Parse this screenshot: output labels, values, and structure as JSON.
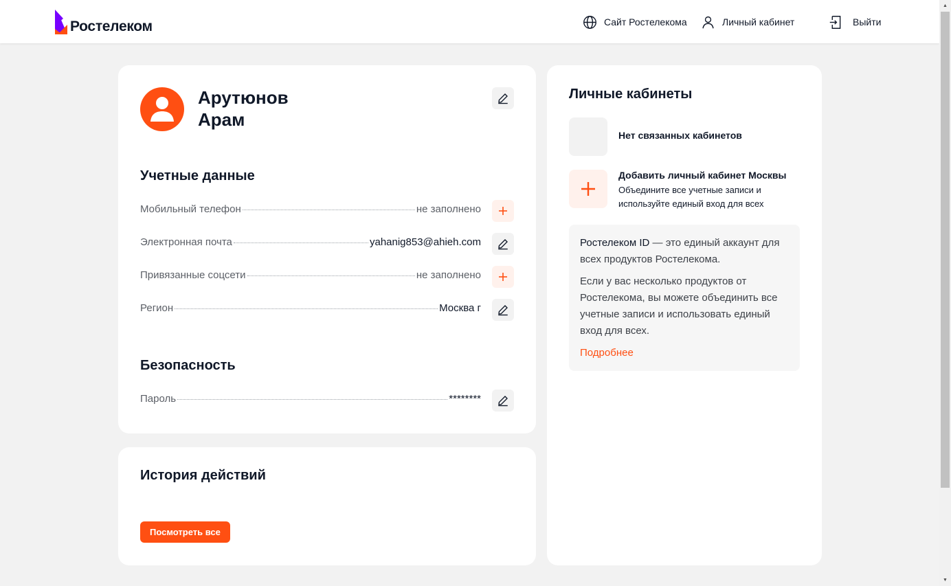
{
  "header": {
    "logo_text": "Ростелеком",
    "site_link": "Сайт Ростелекома",
    "cabinet_link": "Личный кабинет",
    "logout_link": "Выйти"
  },
  "profile": {
    "last_name": "Арутюнов",
    "first_name": "Арам",
    "credentials_title": "Учетные данные",
    "rows": [
      {
        "label": "Мобильный телефон",
        "value": "не заполнено"
      },
      {
        "label": "Электронная почта",
        "value": "yahanig853@ahieh.com"
      },
      {
        "label": "Привязанные соцсети",
        "value": "не заполнено"
      },
      {
        "label": "Регион",
        "value": "Москва г"
      }
    ],
    "security_title": "Безопасность",
    "password_label": "Пароль",
    "password_value": "********"
  },
  "history": {
    "title": "История действий",
    "view_all": "Посмотреть все"
  },
  "accounts": {
    "title": "Личные кабинеты",
    "none_text": "Нет связанных кабинетов",
    "add_title": "Добавить личный кабинет Москвы",
    "add_desc": "Объедините все учетные записи и используйте единый вход для всех",
    "info_lead": "Ростелеком ID",
    "info_p1_rest": " — это единый аккаунт для всех продуктов Ростелекома.",
    "info_p2": "Если у вас несколько продуктов от Ростелекома, вы можете объединить все учетные записи и использовать единый вход для всех.",
    "info_link": "Подробнее"
  },
  "colors": {
    "accent": "#ff4f12",
    "accent_light": "#fff1ec",
    "brand_purple": "#7700ff",
    "background": "#f2f2f2"
  },
  "icons": [
    "globe-icon",
    "user-icon",
    "logout-icon",
    "pencil-icon",
    "plus-icon"
  ]
}
